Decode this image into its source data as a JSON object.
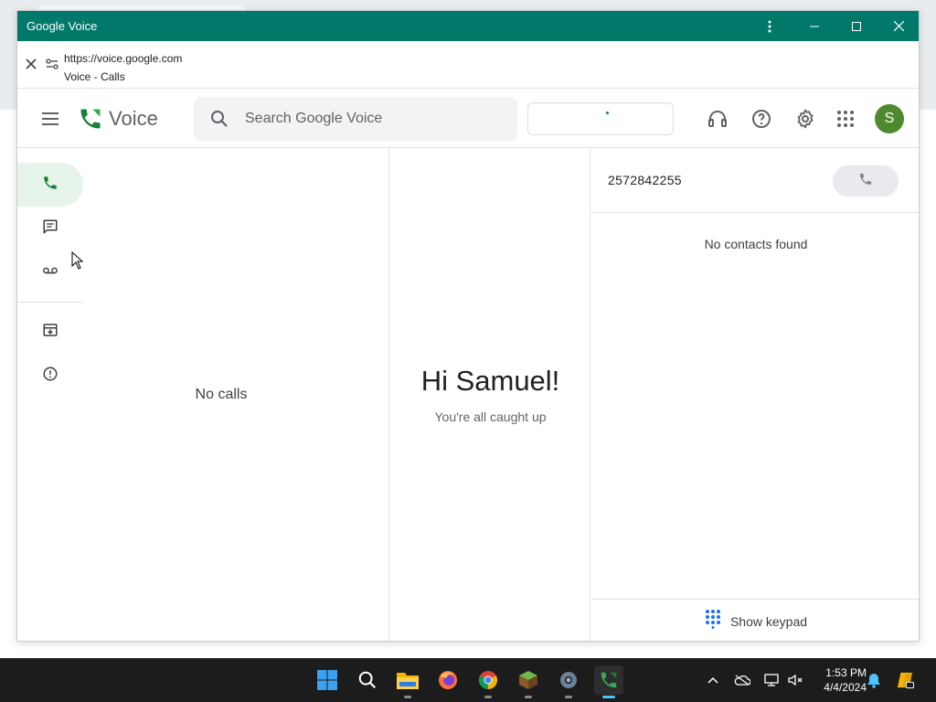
{
  "window": {
    "title": "Google Voice",
    "url": "https://voice.google.com",
    "page_title": "Voice - Calls"
  },
  "header": {
    "app_name": "Voice",
    "search_placeholder": "Search Google Voice",
    "avatar_initial": "S",
    "icons": [
      "menu-icon",
      "voice-logo-icon",
      "search-icon",
      "headset-icon",
      "help-icon",
      "settings-icon",
      "apps-grid-icon"
    ]
  },
  "nav": {
    "items": [
      {
        "name": "calls",
        "icon": "phone-icon",
        "active": true
      },
      {
        "name": "messages",
        "icon": "message-icon",
        "active": false
      },
      {
        "name": "voicemail",
        "icon": "voicemail-icon",
        "active": false
      },
      {
        "name": "archive",
        "icon": "archive-icon",
        "active": false
      },
      {
        "name": "spam",
        "icon": "spam-icon",
        "active": false
      }
    ]
  },
  "calls_pane": {
    "empty_text": "No calls"
  },
  "center_pane": {
    "greeting": "Hi Samuel!",
    "subtitle": "You're all caught up"
  },
  "dialer": {
    "number": "2572842255",
    "no_contacts": "No contacts found",
    "keypad_label": "Show keypad"
  },
  "taskbar": {
    "apps": [
      "windows-start-icon",
      "search-icon",
      "file-explorer-icon",
      "firefox-icon",
      "chrome-icon",
      "minecraft-icon",
      "settings-app-icon",
      "google-voice-app-icon"
    ],
    "time": "1:53 PM",
    "date": "4/4/2024"
  },
  "colors": {
    "titlebar": "#00796b",
    "accent_green": "#188038",
    "avatar": "#4e8a2d",
    "active_nav": "#e6f4ea",
    "taskbar": "#1c1c1c"
  }
}
